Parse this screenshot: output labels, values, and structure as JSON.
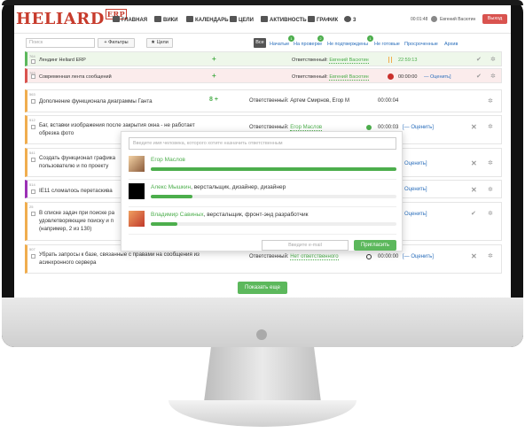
{
  "app": {
    "logo": "HELIARD",
    "logo_suffix": "ERP"
  },
  "nav": [
    {
      "label": "ГЛАВНАЯ",
      "icon": "monitor-icon"
    },
    {
      "label": "ВИКИ",
      "icon": "document-icon"
    },
    {
      "label": "КАЛЕНДАРЬ",
      "icon": "calendar-icon"
    },
    {
      "label": "ЦЕЛИ",
      "icon": "chart-icon"
    },
    {
      "label": "АКТИВНОСТЬ",
      "icon": "lightning-icon"
    },
    {
      "label": "ГРАФИК",
      "icon": "list-icon"
    },
    {
      "label": "3",
      "icon": "gear-icon"
    }
  ],
  "header": {
    "time": "00:01:48",
    "user": "Евгений Васютин",
    "logout": "Выход"
  },
  "toolbar": {
    "search_placeholder": "Поиск",
    "filters_label": "Фильтры",
    "goals_label": "Цели",
    "all_label": "Все",
    "tabs": [
      "Начатые",
      "На проверке",
      "Не подтверждены",
      "Не готовые",
      "Просроченные",
      "Архив"
    ],
    "tab_badges": [
      "1",
      "2",
      "1"
    ]
  },
  "rows": [
    {
      "num": "764",
      "title": "Лендинг Heliard ERP",
      "resp_label": "Ответственный:",
      "resp": "Евгений Васютин",
      "time": "22:59:13",
      "color": "#5cb85c",
      "bg": "#eef7ea"
    },
    {
      "num": "763",
      "title": "Современная лента сообщений",
      "resp_label": "Ответственный:",
      "resp": "Евгений Васютин",
      "time": "00:00:00",
      "rate": "— Оценить]",
      "color": "#d9534f",
      "bg": "#fbecec"
    },
    {
      "num": "563",
      "title": "Дополнение функционала диаграммы Ганта",
      "count": "8",
      "resp_label": "Ответственный:",
      "resp": "Артем Смирнов, Егор М",
      "time": "00:00:04",
      "color": "#f0ad4e",
      "bg": "#fff"
    },
    {
      "num": "512",
      "title": "Баг, вставки изображения после закрытия окна - не работает обрезка фото",
      "resp_label": "Ответственный:",
      "resp": "Егор Маслов",
      "time": "00:00:03",
      "rate": "[— Оценить]",
      "color": "#f0ad4e",
      "bg": "#fff"
    },
    {
      "num": "541",
      "title": "Создать функционал графика пользователю и по проекту",
      "color": "#f0ad4e",
      "bg": "#fff",
      "rate": "Оценить]"
    },
    {
      "num": "514",
      "title": "IE11 сломалось перетаскива",
      "color": "#9b30b5",
      "bg": "#fff",
      "rate": "Оценить]"
    },
    {
      "num": "25",
      "title": "В списке задач при поиске ра удовлетворяющие поиску и п (например, 2 из 130)",
      "color": "#f0ad4e",
      "bg": "#fff",
      "rate": "Оценить]"
    },
    {
      "num": "507",
      "title": "Убрать запросы к базе, связанные с правами на сообщения из асинхронного сервера",
      "resp_label": "Ответственный:",
      "resp": "Нет ответственного",
      "time": "00:00:00",
      "rate": "[— Оценить]",
      "color": "#f0ad4e",
      "bg": "#fff"
    }
  ],
  "popup": {
    "placeholder": "Введите имя человека, которого хотите назначить ответственным",
    "people": [
      {
        "name": "Егор Маслов",
        "roles": "",
        "progress": 1.0
      },
      {
        "name": "Алекс Мышкин",
        "roles": ", верстальщик, дизайнер, дизайнер",
        "progress": 0.17
      },
      {
        "name": "Владимир Савиных",
        "roles": ", верстальщик, фронт-энд разработчик",
        "progress": 0.11
      }
    ],
    "email_placeholder": "Введите e-mail",
    "invite": "Пригласить"
  },
  "more_label": "Показать еще"
}
